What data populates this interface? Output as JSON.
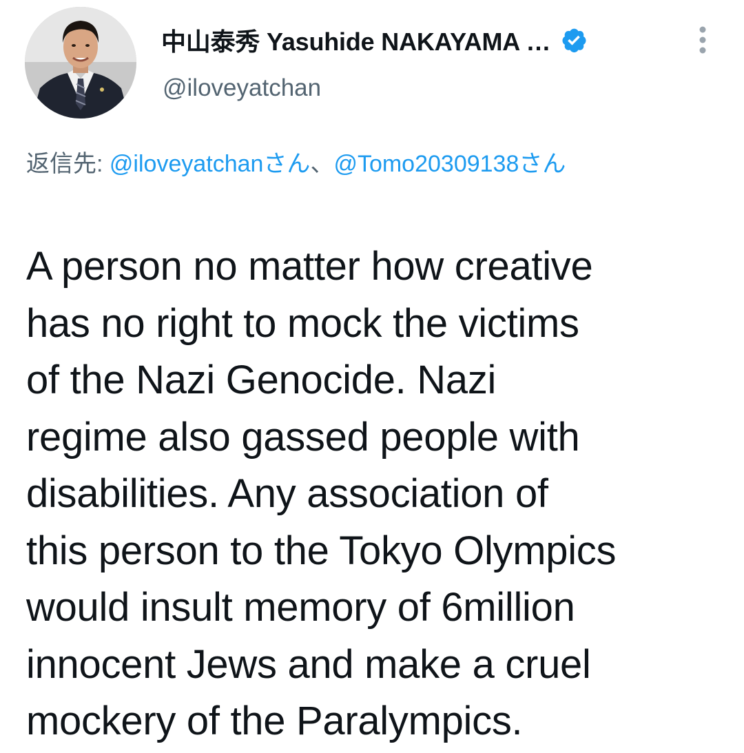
{
  "author": {
    "display_name": "中山泰秀 Yasuhide NAKAYAMA …",
    "handle": "@iloveyatchan",
    "verified": true,
    "avatar_icon": "profile-photo-man-in-suit"
  },
  "more_menu_icon": "vertical-ellipsis-icon",
  "reply_context": {
    "prefix": "返信先: ",
    "mention_1": "@iloveyatchanさん",
    "separator": "、",
    "mention_2": "@Tomo20309138さん"
  },
  "tweet": {
    "lines": [
      "A person no matter how creative",
      "has no right to mock the victims",
      "of the Nazi Genocide. Nazi",
      "regime also gassed people with",
      "disabilities. Any association of",
      "this person to the Tokyo Olympics",
      "would insult memory of 6million",
      "innocent Jews and make a cruel",
      "mockery of the Paralympics."
    ]
  },
  "colors": {
    "link": "#1d9bf0",
    "secondary_text": "#536471",
    "primary_text": "#0f1419",
    "verified_badge": "#1d9bf0"
  }
}
